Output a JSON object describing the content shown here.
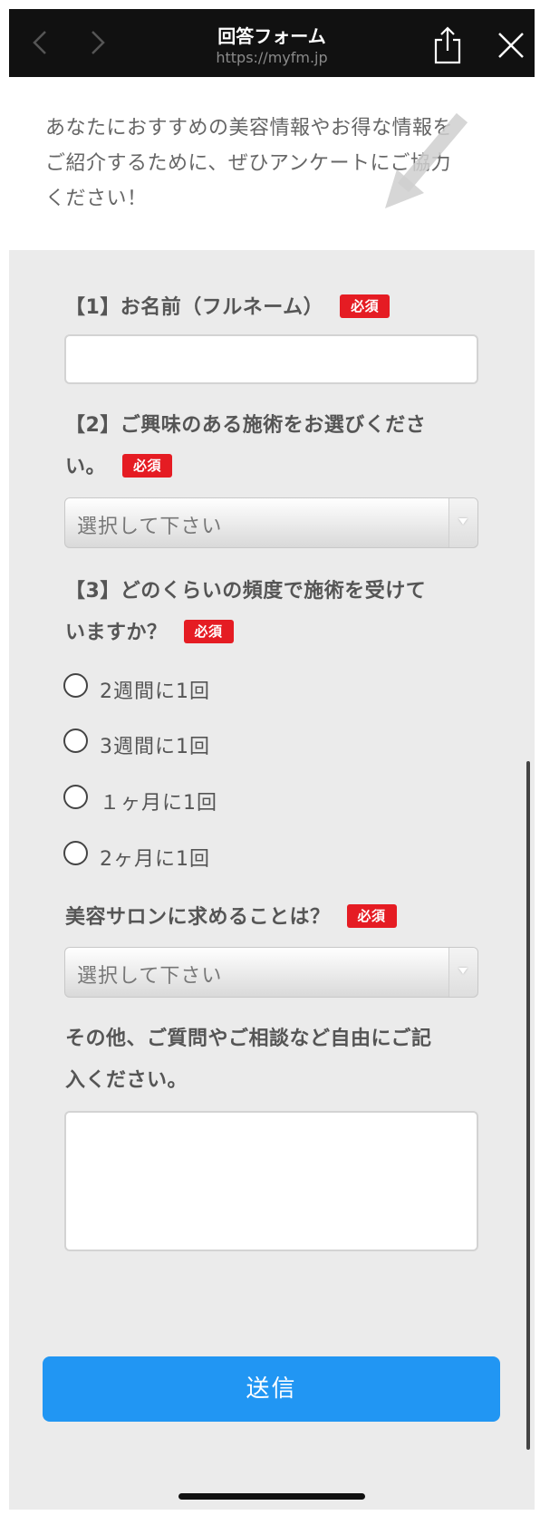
{
  "nav": {
    "title": "回答フォーム",
    "url": "https://myfm.jp",
    "back_icon": "chevron-left-icon",
    "forward_icon": "chevron-right-icon",
    "share_icon": "share-icon",
    "close_icon": "close-icon"
  },
  "intro": {
    "line1": "あなたにおすすめの美容情報やお得な情報を",
    "line2": "ご紹介するために、ぜひアンケートにご協力",
    "line3": "ください！"
  },
  "required_label": "必須",
  "q1": {
    "label": "【1】お名前（フルネーム）",
    "value": ""
  },
  "q2": {
    "label_line1": "【2】ご興味のある施術をお選びくださ",
    "label_line2": "い。",
    "selected": "選択して下さい"
  },
  "q3": {
    "label_line1": "【3】どのくらいの頻度で施術を受けて",
    "label_line2": "いますか？",
    "options": [
      "2週間に1回",
      "3週間に1回",
      "１ヶ月に1回",
      "2ヶ月に1回"
    ]
  },
  "q4": {
    "label": "美容サロンに求めることは？",
    "selected": "選択して下さい"
  },
  "q5": {
    "label_line1": "その他、ご質問やご相談など自由にご記",
    "label_line2": "入ください。",
    "value": ""
  },
  "submit_label": "送信",
  "colors": {
    "required": "#e51c23",
    "submit": "#2196f3",
    "panel": "#ebebeb",
    "nav": "#111111"
  }
}
